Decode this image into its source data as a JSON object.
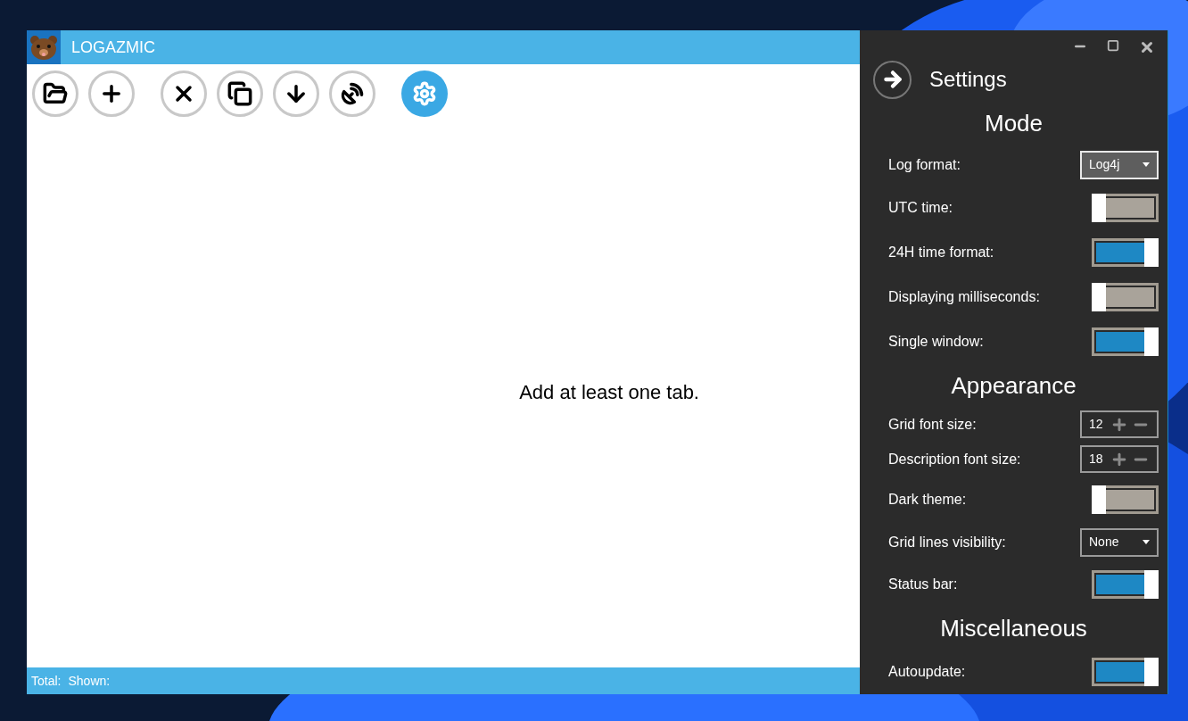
{
  "app": {
    "title": "LOGAZMIC"
  },
  "toolbar": [
    {
      "selected": false
    },
    {
      "selected": false
    },
    {
      "selected": false
    },
    {
      "selected": false
    },
    {
      "selected": false
    },
    {
      "selected": false
    },
    {
      "selected": true
    }
  ],
  "empty_message": "Add at least one tab.",
  "status_bar": {
    "total": "Total:",
    "shown": "Shown:"
  },
  "settings": {
    "title": "Settings",
    "items": [
      {
        "kind": "heading",
        "label": "Mode"
      },
      {
        "kind": "dropdown",
        "label": "Log format:",
        "value": "Log4j",
        "focused": true
      },
      {
        "kind": "toggle",
        "label": "UTC time:",
        "on": false
      },
      {
        "kind": "toggle",
        "label": "24H time format:",
        "on": true
      },
      {
        "kind": "toggle",
        "label": "Displaying milliseconds:",
        "on": false
      },
      {
        "kind": "toggle",
        "label": "Single window:",
        "on": true
      },
      {
        "kind": "heading",
        "label": "Appearance"
      },
      {
        "kind": "stepper",
        "label": "Grid font size:",
        "value": "12"
      },
      {
        "kind": "stepper",
        "label": "Description font size:",
        "value": "18"
      },
      {
        "kind": "toggle",
        "label": "Dark theme:",
        "on": false
      },
      {
        "kind": "dropdown",
        "label": "Grid lines visibility:",
        "value": "None",
        "focused": false
      },
      {
        "kind": "toggle",
        "label": "Status bar:",
        "on": true
      },
      {
        "kind": "heading",
        "label": "Miscellaneous"
      },
      {
        "kind": "toggle",
        "label": "Autoupdate:",
        "on": true
      }
    ]
  }
}
